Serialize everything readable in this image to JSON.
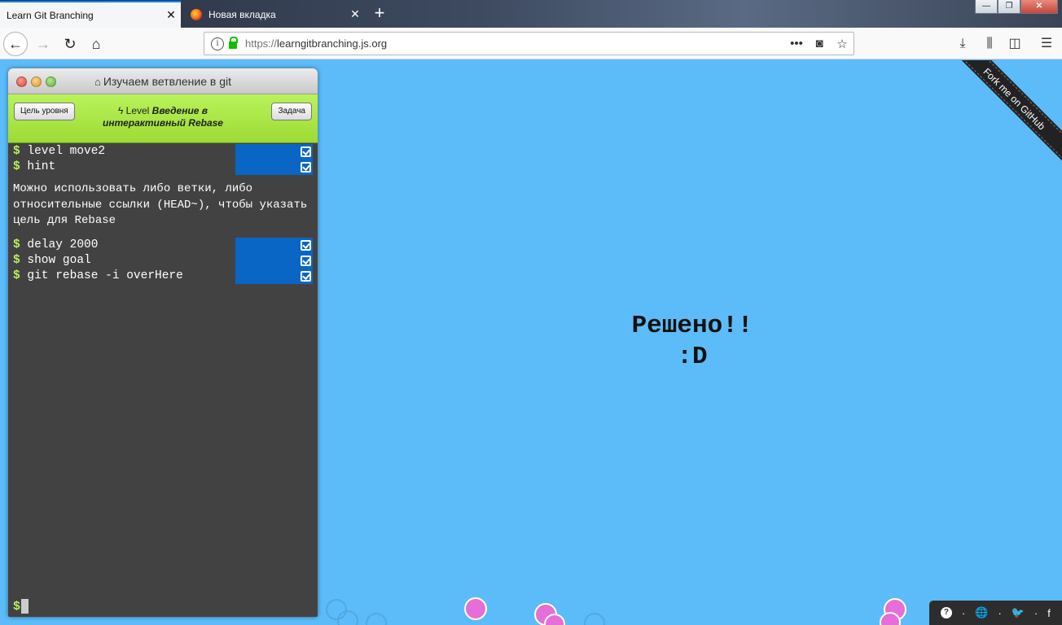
{
  "browser": {
    "tabs": [
      {
        "title": "Learn Git Branching",
        "active": true
      },
      {
        "title": "Новая вкладка",
        "active": false
      }
    ],
    "new_tab_label": "+",
    "url_protocol": "https://",
    "url_host": "learngitbranching.js.org",
    "window_controls": {
      "minimize": "—",
      "maximize": "❐",
      "close": "✕"
    }
  },
  "terminal": {
    "title": "Изучаем ветвление в git",
    "goal_button": "Цель уровня",
    "objective_button": "Задача",
    "level_prefix": "Level",
    "level_name": "Введение в интерактивный Rebase",
    "commands_a": [
      "level move2",
      "hint"
    ],
    "hint": "Можно использовать либо ветки, либо относительные ссылки (HEAD~), чтобы указать цель для Rebase",
    "commands_b": [
      "delay 2000",
      "show goal",
      "git rebase -i overHere"
    ],
    "prompt": "$"
  },
  "solved": {
    "line1": "Решено!!",
    "line2": ":D"
  },
  "ribbon": "Fork me on GitHub",
  "social": [
    "?",
    "·",
    "🌐",
    "·",
    "🐦",
    "·",
    "f"
  ],
  "colors": {
    "page_bg": "#5cbcf9",
    "terminal_bg": "#424242",
    "level_bar": "#a8e843",
    "command_highlight": "#0966c5",
    "prompt": "#b8f35a"
  },
  "icons": [
    "back-arrow-icon",
    "forward-arrow-icon",
    "reload-icon",
    "home-icon",
    "info-icon",
    "lock-icon",
    "page-actions-icon",
    "pocket-icon",
    "bookmark-star-icon",
    "download-icon",
    "library-icon",
    "sidebar-icon",
    "menu-icon",
    "checkbox-icon",
    "help-icon",
    "globe-icon",
    "twitter-icon",
    "facebook-icon"
  ]
}
